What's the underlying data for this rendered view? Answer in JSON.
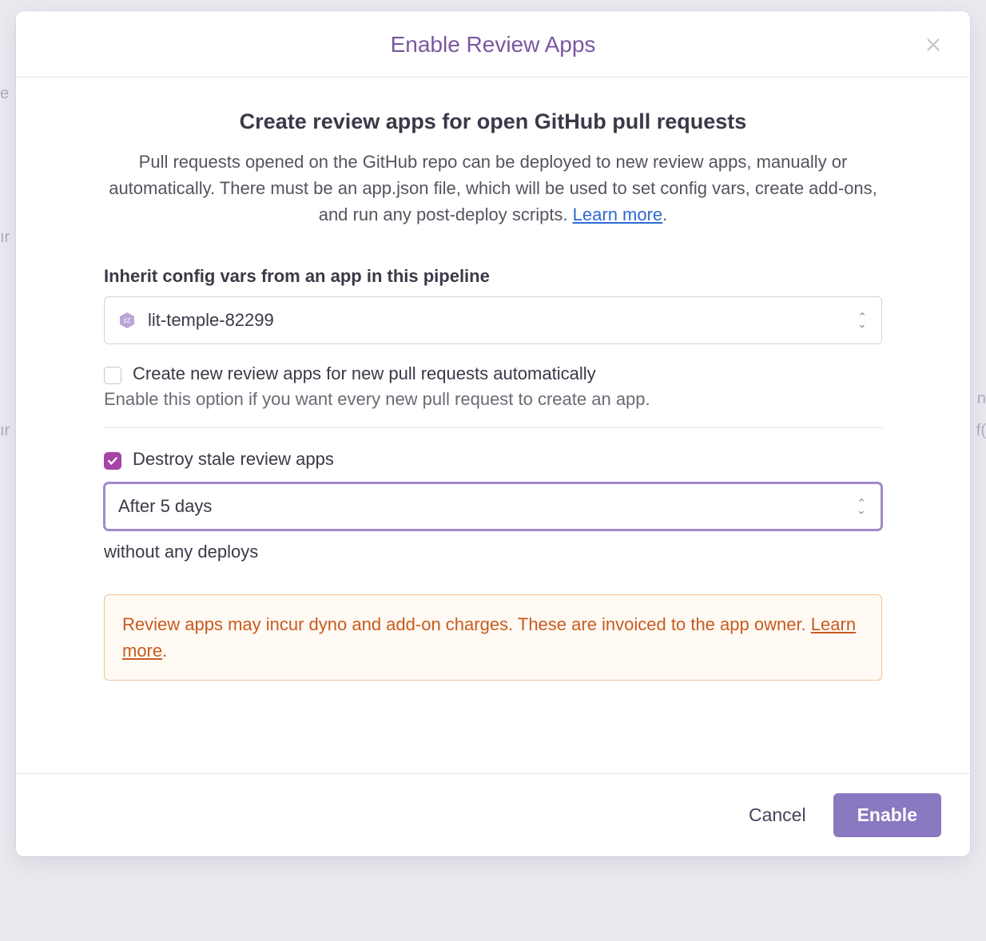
{
  "modal": {
    "title": "Enable Review Apps",
    "heading": "Create review apps for open GitHub pull requests",
    "description_pre": "Pull requests opened on the GitHub repo can be deployed to new review apps, manually or automatically. There must be an app.json file, which will be used to set config vars, create add-ons, and run any post-deploy scripts. ",
    "learn_more": "Learn more",
    "period": ".",
    "inherit_label": "Inherit config vars from an app in this pipeline",
    "inherit_selected": "lit-temple-82299",
    "auto_create_label": "Create new review apps for new pull requests automatically",
    "auto_create_hint": "Enable this option if you want every new pull request to create an app.",
    "destroy_label": "Destroy stale review apps",
    "destroy_selected": "After 5 days",
    "destroy_suffix": "without any deploys",
    "warning_text": "Review apps may incur dyno and add-on charges. These are invoiced to the app owner. ",
    "warning_learn_more": "Learn more",
    "footer": {
      "cancel": "Cancel",
      "enable": "Enable"
    }
  }
}
